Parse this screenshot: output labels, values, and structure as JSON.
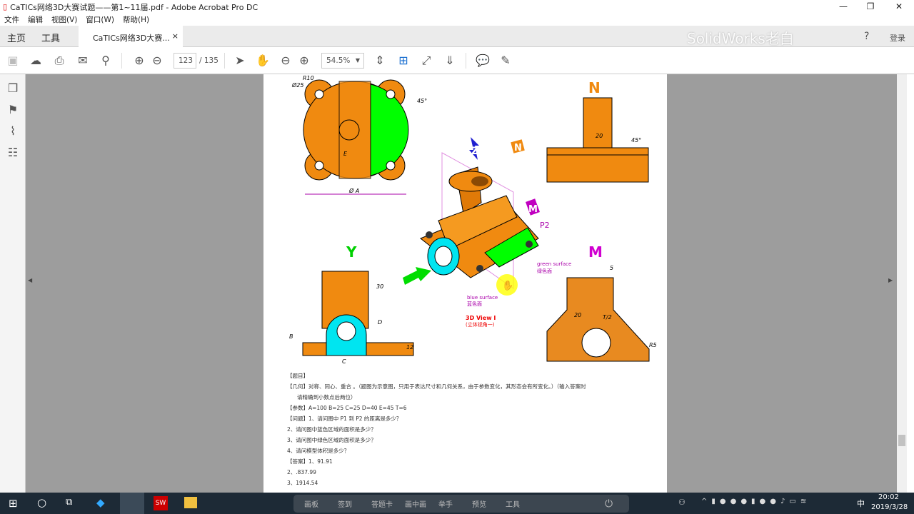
{
  "window": {
    "title": "CaTICs网络3D大赛试题——第1~11届.pdf - Adobe Acrobat Pro DC",
    "minimize": "—",
    "maximize": "❐",
    "close": "✕"
  },
  "menu": [
    "文件",
    "编辑",
    "视图(V)",
    "窗口(W)",
    "帮助(H)"
  ],
  "tabs": {
    "home": "主页",
    "tools": "工具",
    "doc": "CaTICs网络3D大赛...",
    "close": "×",
    "login": "登录",
    "watermark": "SolidWorks老白"
  },
  "toolbar": {
    "page_current": "123",
    "page_total": "/ 135",
    "zoom": "54.5%"
  },
  "drawing": {
    "labels": {
      "n": "N",
      "y": "Y",
      "m": "M",
      "z": "Z",
      "p2": "P2",
      "green_en": "green surface",
      "green_cn": "绿色面",
      "blue_en": "blue surface",
      "blue_cn": "蓝色面",
      "view_title": "3D View I",
      "view_sub": "(立体视角一)"
    },
    "dims": {
      "d25": "Ø25",
      "r10": "R10",
      "a45": "45°",
      "phiA": "Ø A",
      "d20": "20",
      "b45": "45°",
      "d30": "30",
      "B": "B",
      "D": "D",
      "T2": "T/2",
      "C": "C",
      "d12": "12",
      "d5": "5",
      "d20b": "20",
      "r5": "R5",
      "E": "E"
    }
  },
  "question": {
    "heading": "【题目】",
    "geometry": "【几何】对称、同心、重合 。（题图为示意图，只用于表达尺寸和几何关系，由于参数变化，其形态会有所变化。）（输入答案时",
    "geometry2": "请精确到小数点后两位）",
    "params": "【参数】A=100    B=25    C=25    D=40    E=45    T=6",
    "q1": "【问题】1、请问图中 P1 到 P2 的距离是多少？",
    "q2": "2、请问图中蓝色区域的面积是多少？",
    "q3": "3、请问图中绿色区域的面积是多少？",
    "q4": "4、请问模型体积是多少？",
    "a1": "【答案】1、91.91",
    "a2": "2、.837.99",
    "a3": "3、1914.54"
  },
  "taskbar": {
    "toolbar": [
      "画板",
      "签到",
      "答题卡",
      "画中画",
      "举手",
      "预览",
      "工具"
    ],
    "ime": "中",
    "time": "20:02",
    "date": "2019/3/28"
  },
  "colors": {
    "orange": "#f08a10",
    "green": "#00ff00",
    "cyan": "#00e5f0",
    "magenta": "#d000d0"
  }
}
